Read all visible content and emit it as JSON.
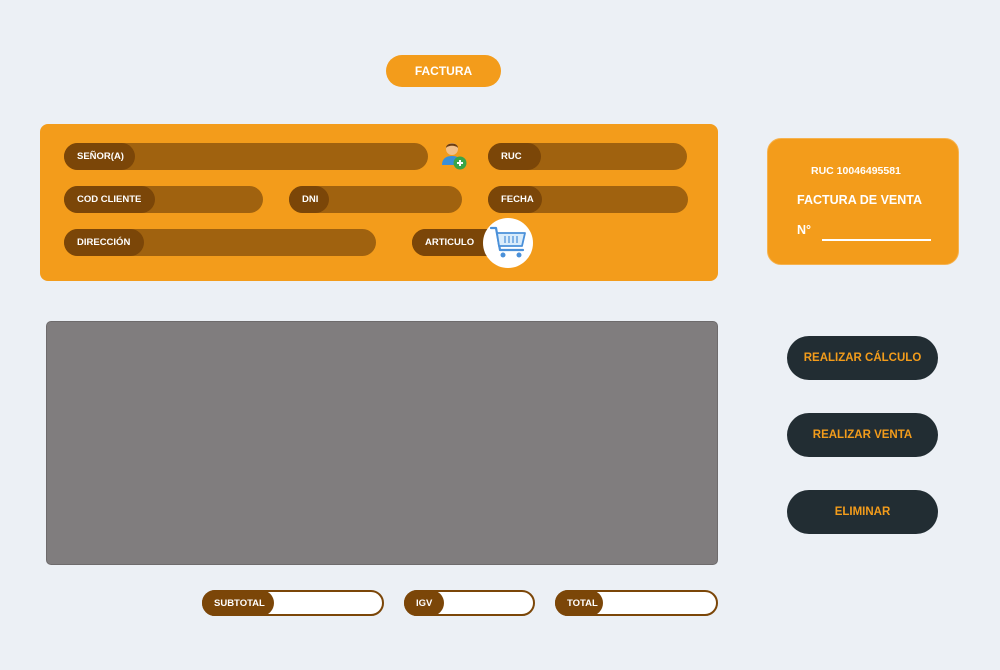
{
  "header": {
    "title": "FACTURA"
  },
  "form": {
    "senor_label": "SEÑOR(A)",
    "ruc_label": "RUC",
    "cod_cliente_label": "COD CLIENTE",
    "dni_label": "DNI",
    "fecha_label": "FECHA",
    "direccion_label": "DIRECCIÓN",
    "articulo_label": "ARTICULO",
    "add_client_icon": "add-user-icon",
    "cart_icon": "shopping-cart-icon"
  },
  "invoice_card": {
    "ruc": "RUC 10046495581",
    "type": "FACTURA DE VENTA",
    "number_label": "N°"
  },
  "actions": {
    "calc_label": "REALIZAR CÁLCULO",
    "sale_label": "REALIZAR VENTA",
    "delete_label": "ELIMINAR"
  },
  "totals": {
    "subtotal_label": "SUBTOTAL",
    "igv_label": "IGV",
    "total_label": "TOTAL"
  },
  "colors": {
    "background": "#ecf0f5",
    "accent": "#f39c1b",
    "field_dark": "#7b4608",
    "field_mid": "#a0620f",
    "button_dark": "#222d33",
    "grid": "#807d7e"
  }
}
